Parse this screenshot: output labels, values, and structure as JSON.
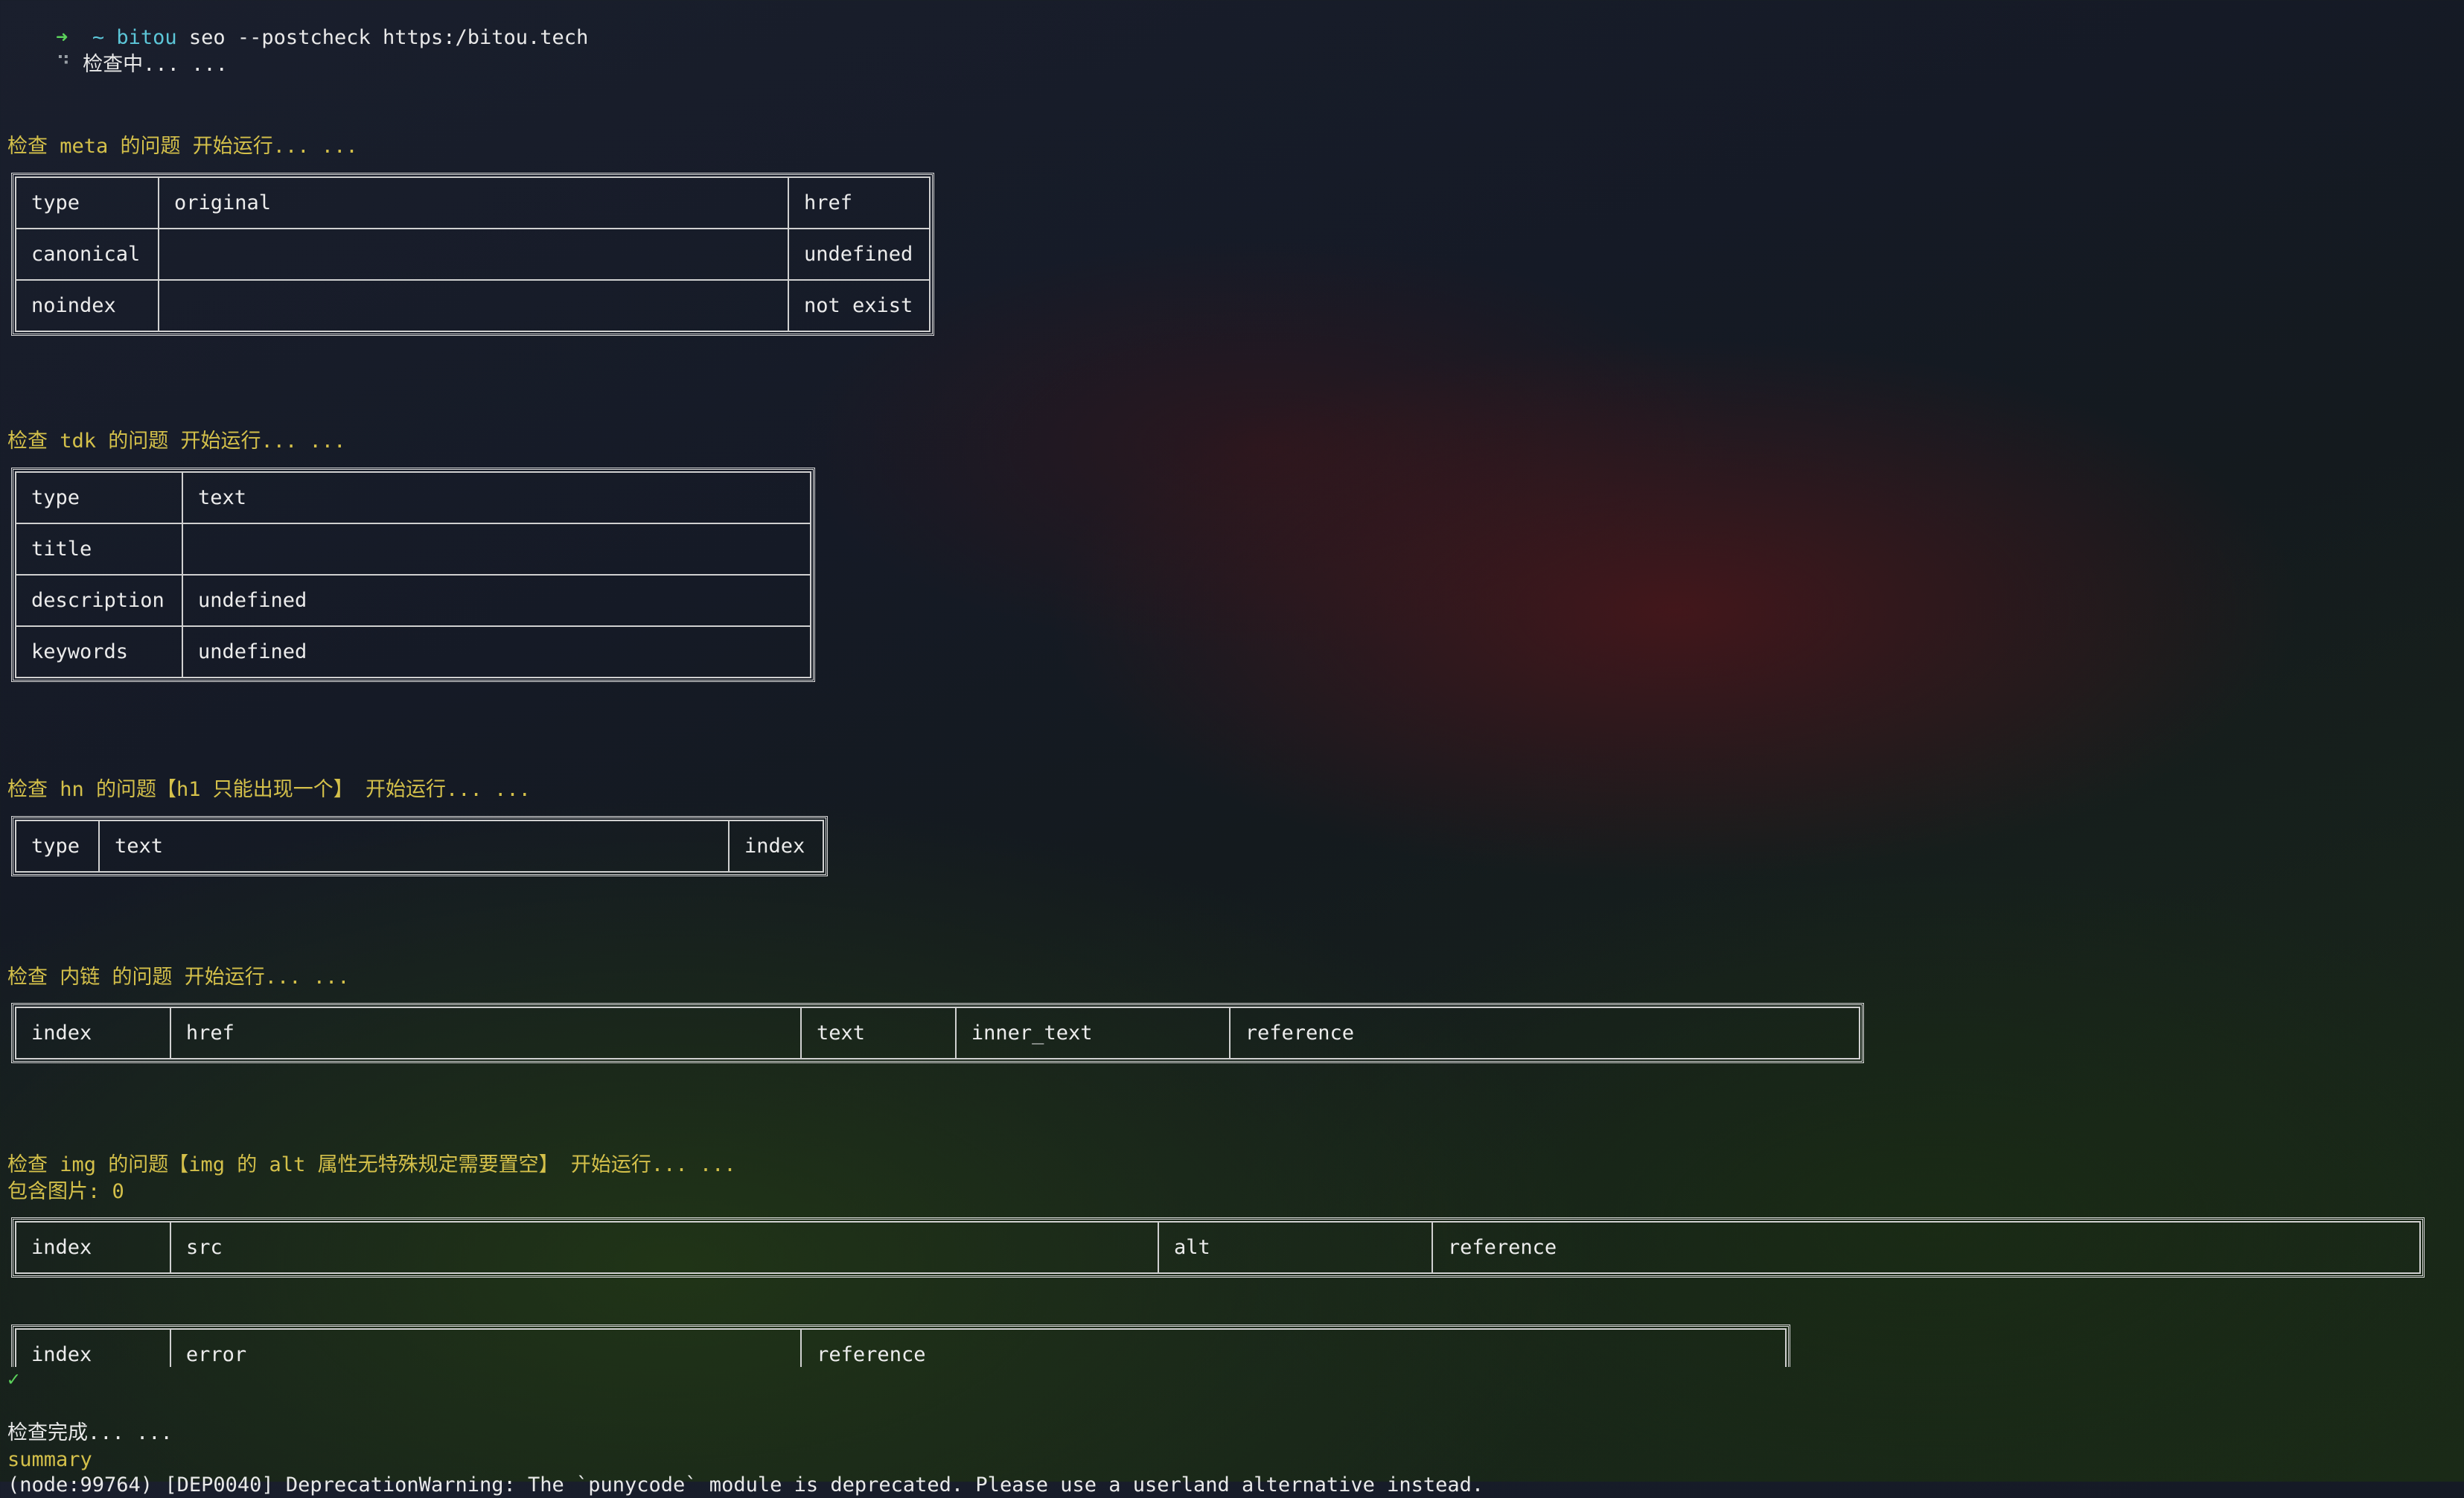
{
  "terminal": {
    "prompt_arrow": "➜",
    "prompt_dir": "~",
    "command_name": "bitou",
    "command_args": "seo --postcheck https:/bitou.tech",
    "spinner": "⠙",
    "checking": "检查中... ...",
    "meta_header": "检查 meta 的问题 开始运行... ...",
    "meta_table": [
      [
        "type",
        "original",
        "href"
      ],
      [
        "canonical",
        "",
        "undefined"
      ],
      [
        "noindex",
        "",
        "not exist"
      ]
    ],
    "tdk_header": "检查 tdk 的问题 开始运行... ...",
    "tdk_table": [
      [
        "type",
        "text"
      ],
      [
        "title",
        ""
      ],
      [
        "description",
        "undefined"
      ],
      [
        "keywords",
        "undefined"
      ]
    ],
    "hn_header": "检查 hn 的问题【h1 只能出现一个】 开始运行... ...",
    "hn_table": [
      [
        "type",
        "text",
        "index"
      ]
    ],
    "link_header": "检查 内链 的问题 开始运行... ...",
    "link_table": [
      [
        "index",
        "href",
        "text",
        "inner_text",
        "reference"
      ]
    ],
    "img_header": "检查 img 的问题【img 的 alt 属性无特殊规定需要置空】 开始运行... ...",
    "img_count": "包含图片: 0",
    "img_table": [
      [
        "index",
        "src",
        "alt",
        "reference"
      ]
    ],
    "error_table": [
      [
        "index",
        "error",
        "reference"
      ]
    ],
    "checkmark": "✓",
    "done": "检查完成... ...",
    "summary": "summary",
    "warning_line": "(node:99764) [DEP0040] DeprecationWarning: The `punycode` module is deprecated. Please use a userland alternative instead."
  },
  "colors": {
    "header_yellow": "#d4c04a",
    "prompt_green": "#5bd25b",
    "command_cyan": "#5cc6d8"
  }
}
